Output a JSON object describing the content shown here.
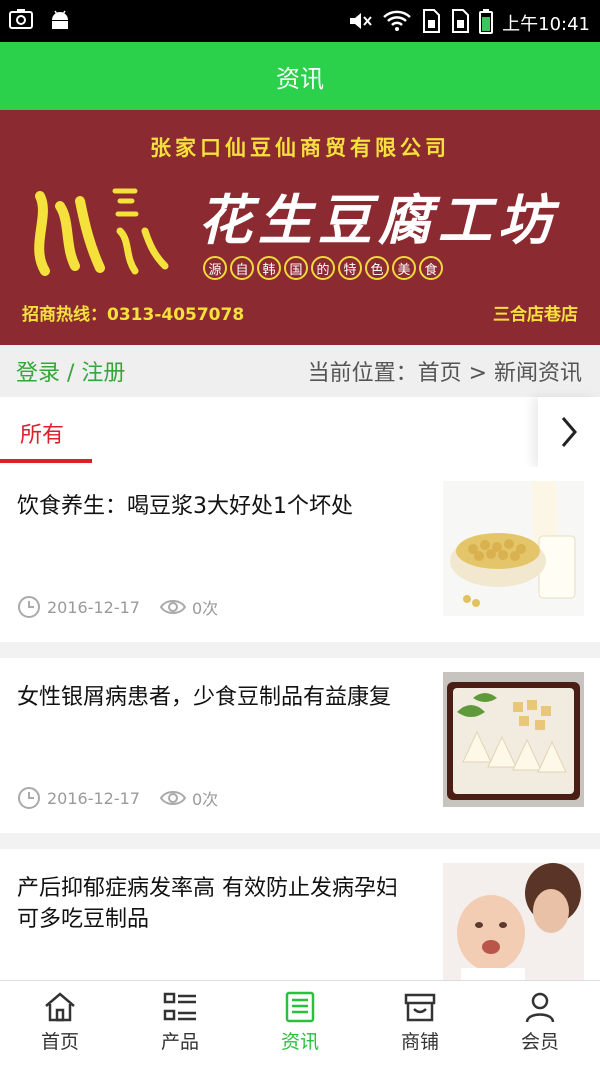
{
  "status_bar": {
    "time": "上午10:41",
    "icons": [
      "screenshot-icon",
      "android-icon",
      "mute-icon",
      "wifi-icon",
      "sim-icon",
      "sim-icon",
      "battery-icon"
    ]
  },
  "app_bar": {
    "title": "资讯"
  },
  "banner": {
    "company": "张家口仙豆仙商贸有限公司",
    "logo_text": "仙豆仙",
    "product": "花生豆腐工坊",
    "slogan_chars": [
      "源",
      "自",
      "韩",
      "国",
      "的",
      "特",
      "色",
      "美",
      "食"
    ],
    "hotline": "招商热线：0313-4057078",
    "address": "三合店巷店"
  },
  "location_bar": {
    "login": "登录 / 注册",
    "breadcrumb": "当前位置：首页 > 新闻资讯"
  },
  "tabs": {
    "active": "所有",
    "more_icon": "chevron-right-icon"
  },
  "news": [
    {
      "title": "饮食养生：喝豆浆3大好处1个坏处",
      "date": "2016-12-17",
      "views": "0次"
    },
    {
      "title": "女性银屑病患者，少食豆制品有益康复",
      "date": "2016-12-17",
      "views": "0次"
    },
    {
      "title": "产后抑郁症病发率高 有效防止发病孕妇可多吃豆制品",
      "date": "",
      "views": ""
    }
  ],
  "bottom_nav": [
    {
      "label": "首页",
      "icon": "home-icon"
    },
    {
      "label": "产品",
      "icon": "list-icon"
    },
    {
      "label": "资讯",
      "icon": "news-icon",
      "active": true
    },
    {
      "label": "商铺",
      "icon": "store-icon"
    },
    {
      "label": "会员",
      "icon": "user-icon"
    }
  ],
  "colors": {
    "app_bar": "#2bd14a",
    "banner_bg": "#8b2a30",
    "accent_red": "#d9202b",
    "active_green": "#2bbf3e"
  }
}
